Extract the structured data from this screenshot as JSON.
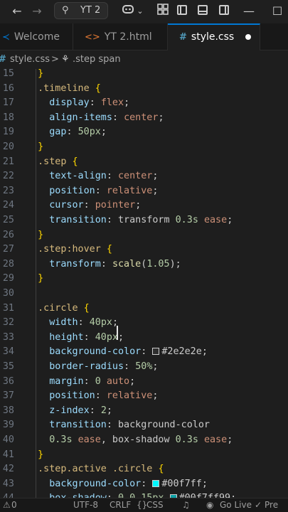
{
  "titlebar": {
    "search_label": "YT 2"
  },
  "tabs": [
    {
      "label": "Welcome",
      "icon": "vscode-logo-icon",
      "color": "#0078d4"
    },
    {
      "label": "YT 2.html",
      "icon": "html-brackets-icon",
      "color": "#e37933"
    },
    {
      "label": "style.css",
      "icon": "hash-icon",
      "color": "#519aba"
    }
  ],
  "breadcrumb": {
    "file": "style.css",
    "separator": ">",
    "symbol": ".step span"
  },
  "editor": {
    "lines": [
      {
        "n": "15",
        "tokens": [
          [
            "  ",
            "pc"
          ],
          [
            "}",
            "br"
          ]
        ]
      },
      {
        "n": "16",
        "tokens": [
          [
            "  ",
            "pc"
          ],
          [
            ".timeline",
            "sel"
          ],
          [
            " ",
            "pc"
          ],
          [
            "{",
            "br"
          ]
        ]
      },
      {
        "n": "17",
        "tokens": [
          [
            "    ",
            "pc"
          ],
          [
            "display",
            "prop"
          ],
          [
            ": ",
            "pc"
          ],
          [
            "flex",
            "val"
          ],
          [
            ";",
            "pc"
          ]
        ]
      },
      {
        "n": "18",
        "tokens": [
          [
            "    ",
            "pc"
          ],
          [
            "align-items",
            "prop"
          ],
          [
            ": ",
            "pc"
          ],
          [
            "center",
            "val"
          ],
          [
            ";",
            "pc"
          ]
        ]
      },
      {
        "n": "19",
        "tokens": [
          [
            "    ",
            "pc"
          ],
          [
            "gap",
            "prop"
          ],
          [
            ": ",
            "pc"
          ],
          [
            "50",
            "num"
          ],
          [
            "px",
            "unit"
          ],
          [
            ";",
            "pc"
          ]
        ]
      },
      {
        "n": "20",
        "tokens": [
          [
            "  ",
            "pc"
          ],
          [
            "}",
            "br"
          ]
        ]
      },
      {
        "n": "21",
        "tokens": [
          [
            "  ",
            "pc"
          ],
          [
            ".step",
            "sel"
          ],
          [
            " ",
            "pc"
          ],
          [
            "{",
            "br"
          ]
        ]
      },
      {
        "n": "22",
        "tokens": [
          [
            "    ",
            "pc"
          ],
          [
            "text-align",
            "prop"
          ],
          [
            ": ",
            "pc"
          ],
          [
            "center",
            "val"
          ],
          [
            ";",
            "pc"
          ]
        ]
      },
      {
        "n": "23",
        "tokens": [
          [
            "    ",
            "pc"
          ],
          [
            "position",
            "prop"
          ],
          [
            ": ",
            "pc"
          ],
          [
            "relative",
            "val"
          ],
          [
            ";",
            "pc"
          ]
        ]
      },
      {
        "n": "24",
        "tokens": [
          [
            "    ",
            "pc"
          ],
          [
            "cursor",
            "prop"
          ],
          [
            ": ",
            "pc"
          ],
          [
            "pointer",
            "val"
          ],
          [
            ";",
            "pc"
          ]
        ]
      },
      {
        "n": "25",
        "tokens": [
          [
            "    ",
            "pc"
          ],
          [
            "transition",
            "prop"
          ],
          [
            ": ",
            "pc"
          ],
          [
            "transform ",
            "pc"
          ],
          [
            "0.3",
            "num"
          ],
          [
            "s",
            "unit"
          ],
          [
            " ",
            "pc"
          ],
          [
            "ease",
            "val"
          ],
          [
            ";",
            "pc"
          ]
        ]
      },
      {
        "n": "26",
        "tokens": [
          [
            "  ",
            "pc"
          ],
          [
            "}",
            "br"
          ]
        ]
      },
      {
        "n": "27",
        "tokens": [
          [
            "  ",
            "pc"
          ],
          [
            ".step",
            "sel"
          ],
          [
            ":hover",
            "sel"
          ],
          [
            " ",
            "pc"
          ],
          [
            "{",
            "br"
          ]
        ]
      },
      {
        "n": "28",
        "tokens": [
          [
            "    ",
            "pc"
          ],
          [
            "transform",
            "prop"
          ],
          [
            ": ",
            "pc"
          ],
          [
            "scale",
            "fn"
          ],
          [
            "(",
            "pc"
          ],
          [
            "1.05",
            "num"
          ],
          [
            ");",
            "pc"
          ]
        ]
      },
      {
        "n": "29",
        "tokens": [
          [
            "  ",
            "pc"
          ],
          [
            "}",
            "br"
          ]
        ]
      },
      {
        "n": "30",
        "tokens": []
      },
      {
        "n": "31",
        "tokens": [
          [
            "  ",
            "pc"
          ],
          [
            ".circle",
            "sel"
          ],
          [
            " ",
            "pc"
          ],
          [
            "{",
            "br"
          ]
        ]
      },
      {
        "n": "32",
        "tokens": [
          [
            "    ",
            "pc"
          ],
          [
            "width",
            "prop"
          ],
          [
            ": ",
            "pc"
          ],
          [
            "40",
            "num"
          ],
          [
            "px",
            "unit"
          ],
          [
            ";",
            "pc"
          ]
        ]
      },
      {
        "n": "33",
        "tokens": [
          [
            "    ",
            "pc"
          ],
          [
            "height",
            "prop"
          ],
          [
            ": ",
            "pc"
          ],
          [
            "40",
            "num"
          ],
          [
            "px",
            "unit"
          ],
          [
            ";",
            "pc"
          ]
        ]
      },
      {
        "n": "34",
        "tokens": [
          [
            "    ",
            "pc"
          ],
          [
            "background-color",
            "prop"
          ],
          [
            ": ",
            "pc"
          ],
          [
            "SW:#2e2e2e",
            "sw"
          ],
          [
            "#2e2e2e",
            "pc"
          ],
          [
            ";",
            "pc"
          ]
        ]
      },
      {
        "n": "35",
        "tokens": [
          [
            "    ",
            "pc"
          ],
          [
            "border-radius",
            "prop"
          ],
          [
            ": ",
            "pc"
          ],
          [
            "50",
            "num"
          ],
          [
            "%",
            "unit"
          ],
          [
            ";",
            "pc"
          ]
        ]
      },
      {
        "n": "36",
        "tokens": [
          [
            "    ",
            "pc"
          ],
          [
            "margin",
            "prop"
          ],
          [
            ": ",
            "pc"
          ],
          [
            "0",
            "num"
          ],
          [
            " ",
            "pc"
          ],
          [
            "auto",
            "val"
          ],
          [
            ";",
            "pc"
          ]
        ]
      },
      {
        "n": "37",
        "tokens": [
          [
            "    ",
            "pc"
          ],
          [
            "position",
            "prop"
          ],
          [
            ": ",
            "pc"
          ],
          [
            "relative",
            "val"
          ],
          [
            ";",
            "pc"
          ]
        ]
      },
      {
        "n": "38",
        "tokens": [
          [
            "    ",
            "pc"
          ],
          [
            "z-index",
            "prop"
          ],
          [
            ": ",
            "pc"
          ],
          [
            "2",
            "num"
          ],
          [
            ";",
            "pc"
          ]
        ]
      },
      {
        "n": "39",
        "tokens": [
          [
            "    ",
            "pc"
          ],
          [
            "transition",
            "prop"
          ],
          [
            ": ",
            "pc"
          ],
          [
            "background-color",
            "pc"
          ]
        ]
      },
      {
        "n": "40",
        "tokens": [
          [
            "    ",
            "pc"
          ],
          [
            "0.3",
            "num"
          ],
          [
            "s",
            "unit"
          ],
          [
            " ",
            "pc"
          ],
          [
            "ease",
            "val"
          ],
          [
            ", box-shadow ",
            "pc"
          ],
          [
            "0.3",
            "num"
          ],
          [
            "s",
            "unit"
          ],
          [
            " ",
            "pc"
          ],
          [
            "ease",
            "val"
          ],
          [
            ";",
            "pc"
          ]
        ]
      },
      {
        "n": "41",
        "tokens": [
          [
            "  ",
            "pc"
          ],
          [
            "}",
            "br"
          ]
        ]
      },
      {
        "n": "42",
        "tokens": [
          [
            "  ",
            "pc"
          ],
          [
            ".step.active",
            "sel"
          ],
          [
            " ",
            "pc"
          ],
          [
            ".circle",
            "sel"
          ],
          [
            " ",
            "pc"
          ],
          [
            "{",
            "br"
          ]
        ]
      },
      {
        "n": "43",
        "tokens": [
          [
            "    ",
            "pc"
          ],
          [
            "background-color",
            "prop"
          ],
          [
            ": ",
            "pc"
          ],
          [
            "SW:#00f7ff",
            "sw"
          ],
          [
            "#00f7ff",
            "pc"
          ],
          [
            ";",
            "pc"
          ]
        ]
      },
      {
        "n": "44",
        "tokens": [
          [
            "    ",
            "pc"
          ],
          [
            "box-shadow",
            "prop"
          ],
          [
            ": ",
            "pc"
          ],
          [
            "0",
            "num"
          ],
          [
            " ",
            "pc"
          ],
          [
            "0",
            "num"
          ],
          [
            " ",
            "pc"
          ],
          [
            "15",
            "num"
          ],
          [
            "px",
            "unit"
          ],
          [
            " ",
            "pc"
          ],
          [
            "SW:#00f7ff99",
            "sw"
          ],
          [
            "#00f7ff99",
            "pc"
          ],
          [
            ";",
            "pc"
          ]
        ]
      }
    ]
  },
  "statusbar": {
    "errors": "0",
    "encoding": "UTF-8",
    "eol": "CRLF",
    "language": "CSS",
    "go_live": "Go Live",
    "prettier": "Pre"
  }
}
